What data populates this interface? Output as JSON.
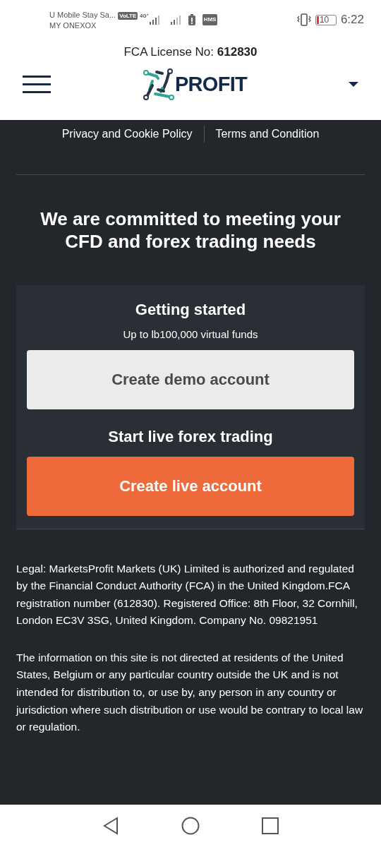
{
  "status_bar": {
    "carrier_1": "U Mobile Stay Sa...",
    "carrier_2": "MY ONEXOX",
    "volte": "VoLTE",
    "network": "4G⁺",
    "hms": "HMS",
    "battery": "10",
    "time": "6:22"
  },
  "license": {
    "label": "FCA License No: ",
    "number": "612830"
  },
  "header": {
    "logo_text": "PROFIT"
  },
  "links": [
    "Privacy and Cookie Policy",
    "Terms and Condition"
  ],
  "headline": "We are committed to meeting your CFD and forex trading needs",
  "card": {
    "title": "Getting started",
    "subtitle": "Up to lb100,000 virtual funds",
    "demo_button": "Create demo account",
    "live_title": "Start live forex trading",
    "live_button": "Create live account"
  },
  "legal": [
    "Legal: MarketsProfit Markets (UK) Limited is authorized and regulated by the Financial Conduct Authority (FCA) in the United Kingdom.FCA registration number (612830). Registered Office: 8th Floor, 32 Cornhill, London EC3V 3SG, United Kingdom. Company No. 09821951",
    "The information on this site is not directed at residents of the United States, Belgium or any particular country outside the UK and is not intended for distribution to, or use by, any person in any country or jurisdiction where such distribution or use would be contrary to local law or regulation."
  ]
}
